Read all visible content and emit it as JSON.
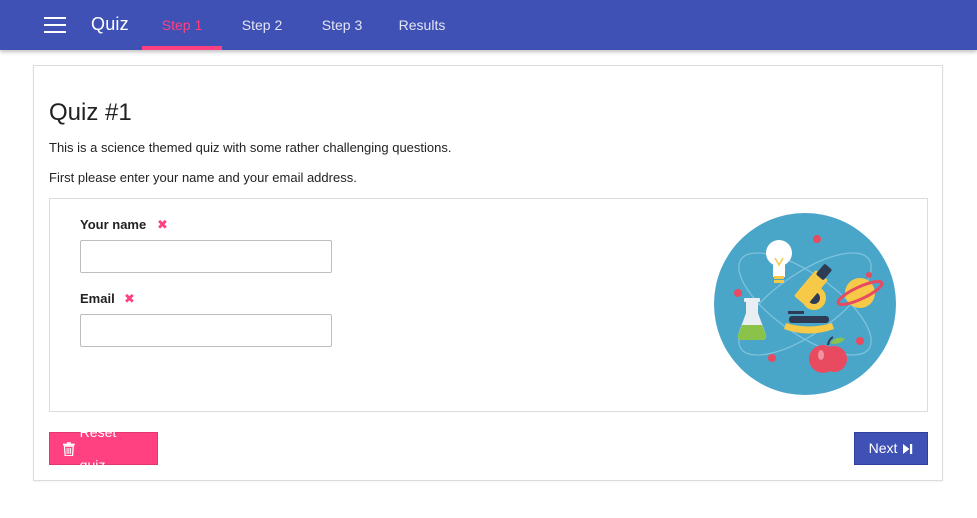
{
  "nav": {
    "brand": "Quiz",
    "tabs": [
      {
        "label": "Step 1",
        "active": true
      },
      {
        "label": "Step 2",
        "active": false
      },
      {
        "label": "Step 3",
        "active": false
      },
      {
        "label": "Results",
        "active": false
      }
    ]
  },
  "quiz": {
    "title": "Quiz #1",
    "intro": [
      "This is a science themed quiz with some rather challenging questions.",
      "First please enter your name and your email address."
    ]
  },
  "form": {
    "name": {
      "label": "Your name",
      "value": "",
      "required_icon": "times-icon"
    },
    "email": {
      "label": "Email",
      "value": "",
      "required_icon": "times-icon"
    }
  },
  "buttons": {
    "reset": {
      "label": "Reset quiz",
      "icon": "trash-icon"
    },
    "next": {
      "label": "Next",
      "icon": "step-forward-icon"
    }
  },
  "colors": {
    "primary": "#3f51b5",
    "accent": "#ff4081",
    "illustration_bg": "#4aa6c9"
  }
}
